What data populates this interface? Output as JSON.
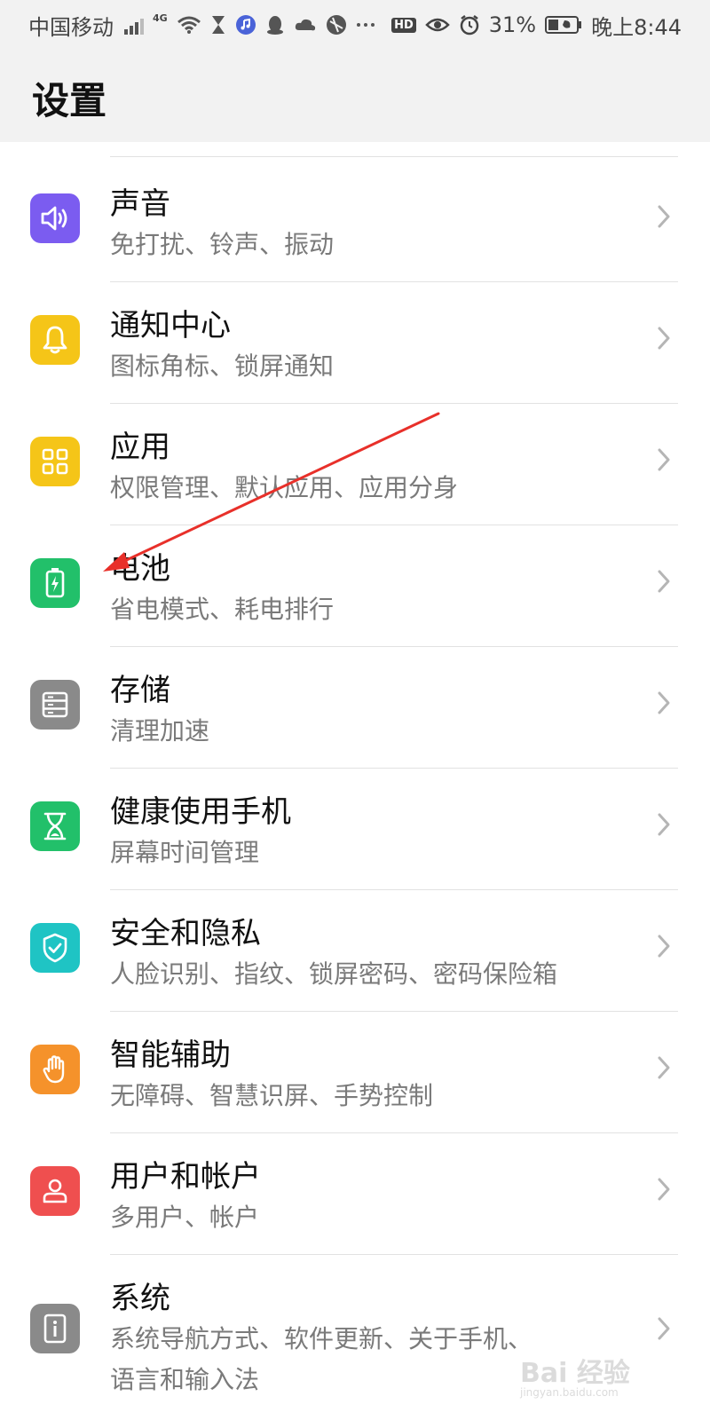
{
  "status_bar": {
    "carrier": "中国移动",
    "network": "4G",
    "battery_percent": "31%",
    "time": "晚上8:44",
    "hd_label": "HD",
    "icons": [
      "signal-icon",
      "wifi-icon",
      "hourglass-icon",
      "music-icon",
      "qq-icon",
      "cloud-icon",
      "browser-icon",
      "more-dots-icon",
      "hd-icon",
      "eye-icon",
      "alarm-icon",
      "battery-icon"
    ]
  },
  "header": {
    "title": "设置"
  },
  "settings": {
    "items": [
      {
        "title": "声音",
        "subtitle": "免打扰、铃声、振动",
        "icon": "speaker-icon",
        "color": "#7b5cf0"
      },
      {
        "title": "通知中心",
        "subtitle": "图标角标、锁屏通知",
        "icon": "bell-icon",
        "color": "#f5c518"
      },
      {
        "title": "应用",
        "subtitle": "权限管理、默认应用、应用分身",
        "icon": "apps-grid-icon",
        "color": "#f5c518"
      },
      {
        "title": "电池",
        "subtitle": "省电模式、耗电排行",
        "icon": "battery-charging-icon",
        "color": "#22c06a"
      },
      {
        "title": "存储",
        "subtitle": "清理加速",
        "icon": "storage-icon",
        "color": "#8a8a8a"
      },
      {
        "title": "健康使用手机",
        "subtitle": "屏幕时间管理",
        "icon": "hourglass-icon",
        "color": "#22c06a"
      },
      {
        "title": "安全和隐私",
        "subtitle": "人脸识别、指纹、锁屏密码、密码保险箱",
        "icon": "shield-check-icon",
        "color": "#1fc4c4"
      },
      {
        "title": "智能辅助",
        "subtitle": "无障碍、智慧识屏、手势控制",
        "icon": "hand-icon",
        "color": "#f5922b"
      },
      {
        "title": "用户和帐户",
        "subtitle": "多用户、帐户",
        "icon": "user-icon",
        "color": "#ef4f4f"
      },
      {
        "title": "系统",
        "subtitle": "系统导航方式、软件更新、关于手机、",
        "subtitle2": "语言和输入法",
        "icon": "info-icon",
        "color": "#8a8a8a"
      }
    ]
  },
  "watermark": {
    "text": "Bai 经验",
    "url": "jingyan.baidu.com"
  },
  "colors": {
    "header_bg": "#f2f2f2",
    "divider": "#e2e2e2",
    "subtitle": "#7a7a7a",
    "annotation_arrow": "#e8302a"
  }
}
